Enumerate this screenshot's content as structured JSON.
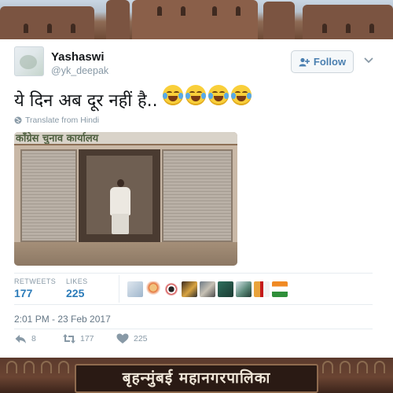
{
  "tweet": {
    "display_name": "Yashaswi",
    "handle": "@yk_deepak",
    "follow_label": "Follow",
    "text": "ये दिन अब दूर नहीं है..",
    "emojis": [
      "face-with-tears-of-joy",
      "face-with-tears-of-joy",
      "face-with-tears-of-joy",
      "face-with-tears-of-joy"
    ],
    "translate_label": "Translate from Hindi",
    "media": {
      "board_text": "काँग्रेस चुनाव कार्यालय"
    },
    "stats": {
      "retweets_label": "RETWEETS",
      "retweets": "177",
      "likes_label": "LIKES",
      "likes": "225"
    },
    "timestamp": "2:01 PM - 23 Feb 2017",
    "actions": {
      "reply_count": "8",
      "retweet_count": "177",
      "like_count": "225"
    }
  },
  "background": {
    "sign_text": "बृहन्मुंबई महानगरपालिका"
  },
  "colors": {
    "link_blue": "#2b7bb9",
    "muted_gray": "#8899a6",
    "emoji_yellow": "#f9cf3a"
  }
}
